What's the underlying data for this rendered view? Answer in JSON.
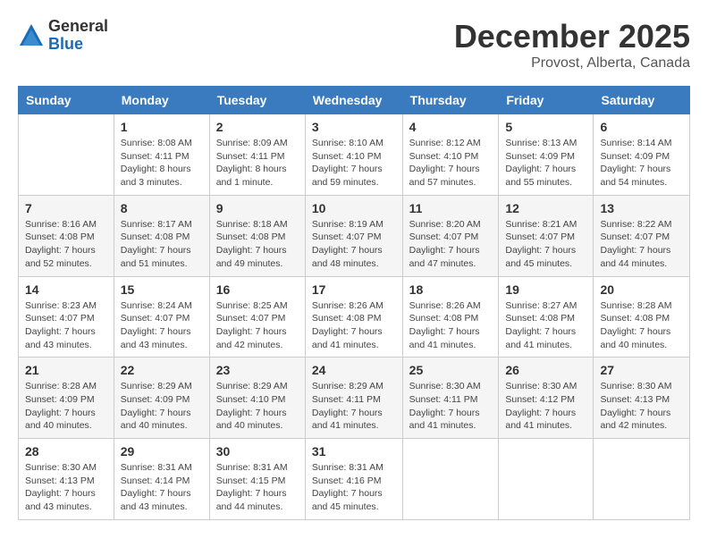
{
  "logo": {
    "general": "General",
    "blue": "Blue"
  },
  "title": "December 2025",
  "location": "Provost, Alberta, Canada",
  "days_of_week": [
    "Sunday",
    "Monday",
    "Tuesday",
    "Wednesday",
    "Thursday",
    "Friday",
    "Saturday"
  ],
  "weeks": [
    [
      {
        "day": "",
        "info": ""
      },
      {
        "day": "1",
        "info": "Sunrise: 8:08 AM\nSunset: 4:11 PM\nDaylight: 8 hours\nand 3 minutes."
      },
      {
        "day": "2",
        "info": "Sunrise: 8:09 AM\nSunset: 4:11 PM\nDaylight: 8 hours\nand 1 minute."
      },
      {
        "day": "3",
        "info": "Sunrise: 8:10 AM\nSunset: 4:10 PM\nDaylight: 7 hours\nand 59 minutes."
      },
      {
        "day": "4",
        "info": "Sunrise: 8:12 AM\nSunset: 4:10 PM\nDaylight: 7 hours\nand 57 minutes."
      },
      {
        "day": "5",
        "info": "Sunrise: 8:13 AM\nSunset: 4:09 PM\nDaylight: 7 hours\nand 55 minutes."
      },
      {
        "day": "6",
        "info": "Sunrise: 8:14 AM\nSunset: 4:09 PM\nDaylight: 7 hours\nand 54 minutes."
      }
    ],
    [
      {
        "day": "7",
        "info": "Sunrise: 8:16 AM\nSunset: 4:08 PM\nDaylight: 7 hours\nand 52 minutes."
      },
      {
        "day": "8",
        "info": "Sunrise: 8:17 AM\nSunset: 4:08 PM\nDaylight: 7 hours\nand 51 minutes."
      },
      {
        "day": "9",
        "info": "Sunrise: 8:18 AM\nSunset: 4:08 PM\nDaylight: 7 hours\nand 49 minutes."
      },
      {
        "day": "10",
        "info": "Sunrise: 8:19 AM\nSunset: 4:07 PM\nDaylight: 7 hours\nand 48 minutes."
      },
      {
        "day": "11",
        "info": "Sunrise: 8:20 AM\nSunset: 4:07 PM\nDaylight: 7 hours\nand 47 minutes."
      },
      {
        "day": "12",
        "info": "Sunrise: 8:21 AM\nSunset: 4:07 PM\nDaylight: 7 hours\nand 45 minutes."
      },
      {
        "day": "13",
        "info": "Sunrise: 8:22 AM\nSunset: 4:07 PM\nDaylight: 7 hours\nand 44 minutes."
      }
    ],
    [
      {
        "day": "14",
        "info": "Sunrise: 8:23 AM\nSunset: 4:07 PM\nDaylight: 7 hours\nand 43 minutes."
      },
      {
        "day": "15",
        "info": "Sunrise: 8:24 AM\nSunset: 4:07 PM\nDaylight: 7 hours\nand 43 minutes."
      },
      {
        "day": "16",
        "info": "Sunrise: 8:25 AM\nSunset: 4:07 PM\nDaylight: 7 hours\nand 42 minutes."
      },
      {
        "day": "17",
        "info": "Sunrise: 8:26 AM\nSunset: 4:08 PM\nDaylight: 7 hours\nand 41 minutes."
      },
      {
        "day": "18",
        "info": "Sunrise: 8:26 AM\nSunset: 4:08 PM\nDaylight: 7 hours\nand 41 minutes."
      },
      {
        "day": "19",
        "info": "Sunrise: 8:27 AM\nSunset: 4:08 PM\nDaylight: 7 hours\nand 41 minutes."
      },
      {
        "day": "20",
        "info": "Sunrise: 8:28 AM\nSunset: 4:08 PM\nDaylight: 7 hours\nand 40 minutes."
      }
    ],
    [
      {
        "day": "21",
        "info": "Sunrise: 8:28 AM\nSunset: 4:09 PM\nDaylight: 7 hours\nand 40 minutes."
      },
      {
        "day": "22",
        "info": "Sunrise: 8:29 AM\nSunset: 4:09 PM\nDaylight: 7 hours\nand 40 minutes."
      },
      {
        "day": "23",
        "info": "Sunrise: 8:29 AM\nSunset: 4:10 PM\nDaylight: 7 hours\nand 40 minutes."
      },
      {
        "day": "24",
        "info": "Sunrise: 8:29 AM\nSunset: 4:11 PM\nDaylight: 7 hours\nand 41 minutes."
      },
      {
        "day": "25",
        "info": "Sunrise: 8:30 AM\nSunset: 4:11 PM\nDaylight: 7 hours\nand 41 minutes."
      },
      {
        "day": "26",
        "info": "Sunrise: 8:30 AM\nSunset: 4:12 PM\nDaylight: 7 hours\nand 41 minutes."
      },
      {
        "day": "27",
        "info": "Sunrise: 8:30 AM\nSunset: 4:13 PM\nDaylight: 7 hours\nand 42 minutes."
      }
    ],
    [
      {
        "day": "28",
        "info": "Sunrise: 8:30 AM\nSunset: 4:13 PM\nDaylight: 7 hours\nand 43 minutes."
      },
      {
        "day": "29",
        "info": "Sunrise: 8:31 AM\nSunset: 4:14 PM\nDaylight: 7 hours\nand 43 minutes."
      },
      {
        "day": "30",
        "info": "Sunrise: 8:31 AM\nSunset: 4:15 PM\nDaylight: 7 hours\nand 44 minutes."
      },
      {
        "day": "31",
        "info": "Sunrise: 8:31 AM\nSunset: 4:16 PM\nDaylight: 7 hours\nand 45 minutes."
      },
      {
        "day": "",
        "info": ""
      },
      {
        "day": "",
        "info": ""
      },
      {
        "day": "",
        "info": ""
      }
    ]
  ]
}
